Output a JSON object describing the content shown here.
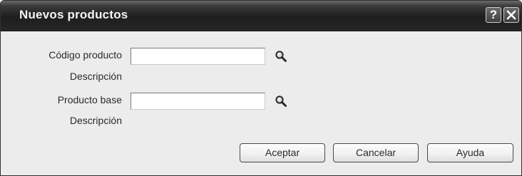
{
  "window": {
    "title": "Nuevos productos",
    "help_glyph": "?",
    "close_icon": "close-icon"
  },
  "form": {
    "product_code_label": "Código producto",
    "product_code_value": "",
    "description_1_label": "Descripción",
    "base_product_label": "Producto base",
    "base_product_value": "",
    "description_2_label": "Descripción",
    "search_icon": "magnifier-icon"
  },
  "buttons": {
    "accept": "Aceptar",
    "cancel": "Cancelar",
    "help": "Ayuda"
  },
  "colors": {
    "titlebar": "#1e1e1e",
    "title_text": "#f4f4f4",
    "dialog_bg": "#ececec"
  }
}
